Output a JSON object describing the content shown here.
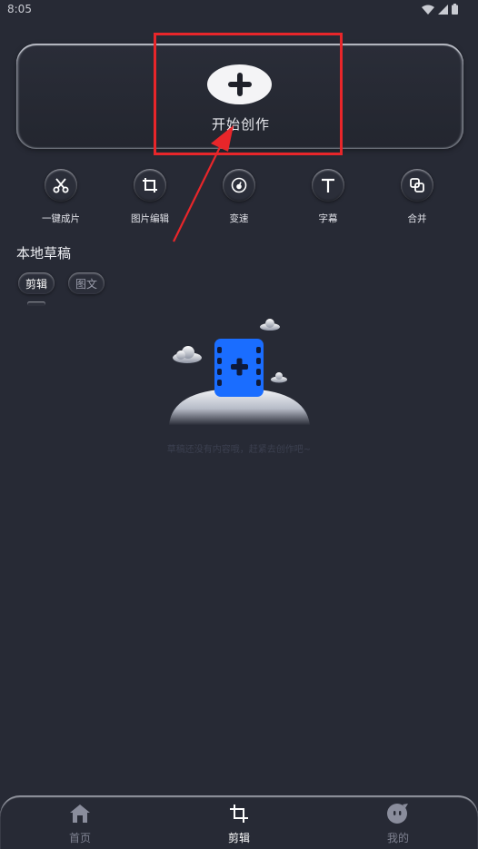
{
  "status_bar": {
    "time": "8:05"
  },
  "create": {
    "label": "开始创作"
  },
  "tools": [
    {
      "label": "一键成片",
      "icon": "scissors-icon"
    },
    {
      "label": "图片编辑",
      "icon": "crop-icon"
    },
    {
      "label": "变速",
      "icon": "speed-gauge-icon"
    },
    {
      "label": "字幕",
      "icon": "text-icon"
    },
    {
      "label": "合并",
      "icon": "merge-icon"
    }
  ],
  "drafts": {
    "title": "本地草稿",
    "tabs": [
      {
        "label": "剪辑",
        "active": true
      },
      {
        "label": "图文",
        "active": false
      }
    ],
    "empty_message": "草稿还没有内容哦，赶紧去创作吧~"
  },
  "bottom_nav": [
    {
      "label": "首页",
      "icon": "home-icon",
      "active": false
    },
    {
      "label": "剪辑",
      "icon": "crop-icon",
      "active": true
    },
    {
      "label": "我的",
      "icon": "chat-face-icon",
      "active": false
    }
  ],
  "colors": {
    "background": "#272a35",
    "accent_blue": "#1a6dff",
    "annotation_red": "#e8262a"
  }
}
